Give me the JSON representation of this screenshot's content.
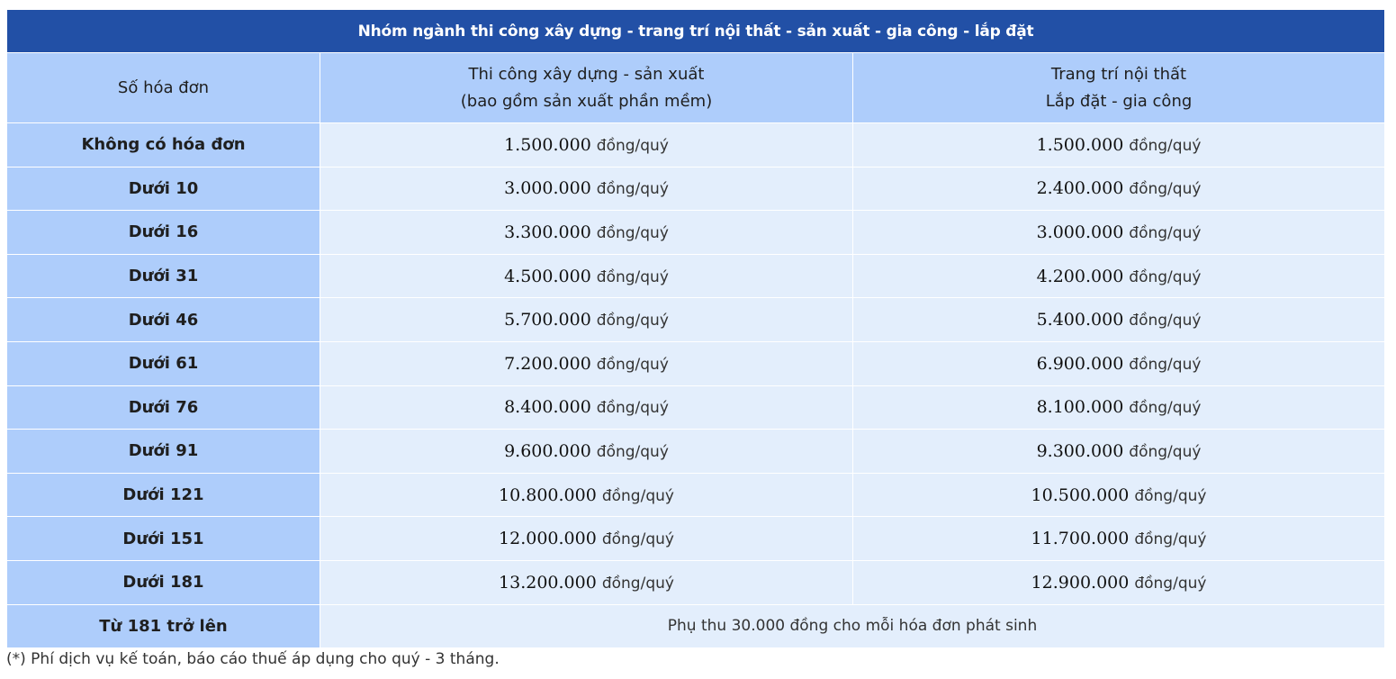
{
  "table": {
    "title": "Nhóm ngành thi công xây dựng - trang trí nội thất - sản xuất - gia công - lắp đặt",
    "headers": {
      "col1": "Số hóa đơn",
      "col2_line1": "Thi công xây dựng - sản xuất",
      "col2_line2": "(bao gồm sản xuất phần mềm)",
      "col3_line1": "Trang trí nội thất",
      "col3_line2": "Lắp đặt - gia công"
    },
    "unit": "đồng/quý",
    "rows": [
      {
        "label": "Không có hóa đơn",
        "construction": "1.500.000",
        "interior": "1.500.000"
      },
      {
        "label": "Dưới 10",
        "construction": "3.000.000",
        "interior": "2.400.000"
      },
      {
        "label": "Dưới 16",
        "construction": "3.300.000",
        "interior": "3.000.000"
      },
      {
        "label": "Dưới 31",
        "construction": "4.500.000",
        "interior": "4.200.000"
      },
      {
        "label": "Dưới 46",
        "construction": "5.700.000",
        "interior": "5.400.000"
      },
      {
        "label": "Dưới 61",
        "construction": "7.200.000",
        "interior": "6.900.000"
      },
      {
        "label": "Dưới 76",
        "construction": "8.400.000",
        "interior": "8.100.000"
      },
      {
        "label": "Dưới 91",
        "construction": "9.600.000",
        "interior": "9.300.000"
      },
      {
        "label": "Dưới 121",
        "construction": "10.800.000",
        "interior": "10.500.000"
      },
      {
        "label": "Dưới 151",
        "construction": "12.000.000",
        "interior": "11.700.000"
      },
      {
        "label": "Dưới 181",
        "construction": "13.200.000",
        "interior": "12.900.000"
      }
    ],
    "last_row": {
      "label": "Từ 181 trở lên",
      "text": "Phụ thu 30.000 đồng cho mỗi hóa đơn phát sinh"
    }
  },
  "footnote": "(*) Phí dịch vụ kế toán, báo cáo thuế áp dụng cho quý - 3 tháng.",
  "colors": {
    "title_bg": "#2250a6",
    "header_bg": "#aecdfb",
    "cell_bg": "#e3eefc"
  }
}
